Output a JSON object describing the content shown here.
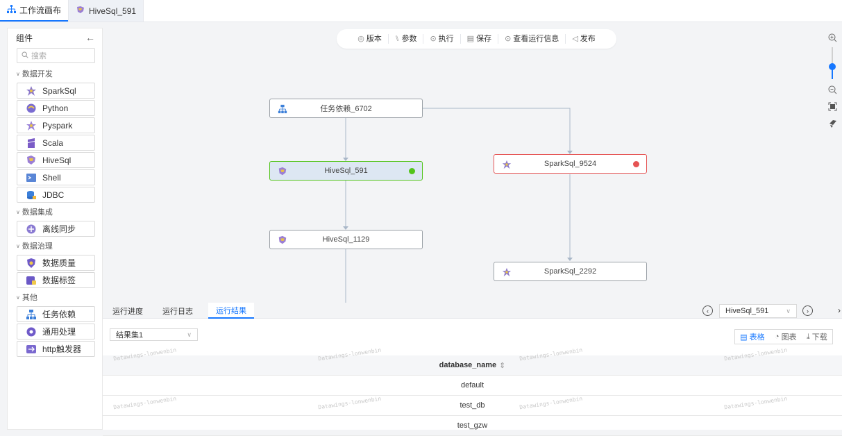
{
  "tabs": [
    {
      "label": "工作流画布",
      "icon": "workflow-icon"
    },
    {
      "label": "HiveSql_591",
      "icon": "hive-icon"
    }
  ],
  "sidebar": {
    "title": "组件",
    "search_placeholder": "搜索",
    "groups": [
      {
        "label": "数据开发",
        "items": [
          "SparkSql",
          "Python",
          "Pyspark",
          "Scala",
          "HiveSql",
          "Shell",
          "JDBC"
        ]
      },
      {
        "label": "数据集成",
        "items": [
          "离线同步"
        ]
      },
      {
        "label": "数据治理",
        "items": [
          "数据质量",
          "数据标签"
        ]
      },
      {
        "label": "其他",
        "items": [
          "任务依赖",
          "通用处理",
          "http触发器"
        ]
      }
    ]
  },
  "toolbar": {
    "version": "版本",
    "params": "参数",
    "execute": "执行",
    "save": "保存",
    "run_info": "查看运行信息",
    "publish": "发布"
  },
  "nodes": [
    {
      "label": "任务依赖_6702",
      "icon": "dependency-icon",
      "status": ""
    },
    {
      "label": "HiveSql_591",
      "icon": "hive-icon",
      "status": "success"
    },
    {
      "label": "SparkSql_9524",
      "icon": "spark-icon",
      "status": "error"
    },
    {
      "label": "HiveSql_1129",
      "icon": "hive-icon",
      "status": ""
    },
    {
      "label": "SparkSql_2292",
      "icon": "spark-icon",
      "status": ""
    }
  ],
  "bottom": {
    "tabs": [
      "运行进度",
      "运行日志",
      "运行结果"
    ],
    "active_tab": "运行结果",
    "node_select": "HiveSql_591",
    "result_set": "结果集1",
    "actions": {
      "table": "表格",
      "chart": "图表",
      "download": "下载"
    },
    "column_header": "database_name",
    "rows": [
      "default",
      "test_db",
      "test_gzw"
    ],
    "watermark": "Datawings-lonwenbin"
  },
  "colors": {
    "accent": "#1677ff",
    "success": "#52c41a",
    "error": "#e55353",
    "selected_node_bg": "#dde7f3"
  }
}
